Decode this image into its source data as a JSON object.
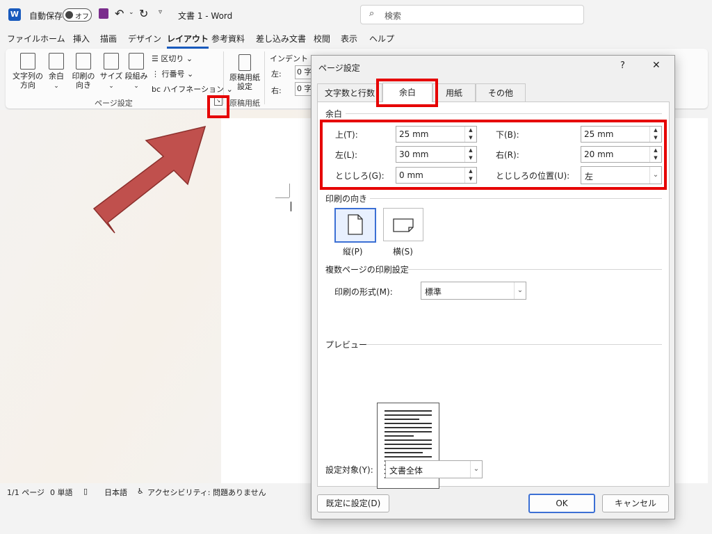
{
  "titlebar": {
    "autosave_label": "自動保存",
    "toggle_state": "オフ",
    "doc_title": "文書 1 - Word",
    "search_placeholder": "検索"
  },
  "menu": [
    "ファイル",
    "ホーム",
    "挿入",
    "描画",
    "デザイン",
    "レイアウト",
    "参考資料",
    "差し込み文書",
    "校閲",
    "表示",
    "ヘルプ"
  ],
  "menu_active": "レイアウト",
  "ribbon": {
    "text_direction": "文字列の\n方向",
    "margins": "余白",
    "orientation": "印刷の\n向き",
    "size": "サイズ",
    "columns": "段組み",
    "breaks": "区切り",
    "line_numbers": "行番号",
    "hyphenation": "ハイフネーション",
    "page_setup_group": "ページ設定",
    "genko": "原稿用紙\n設定",
    "genko_group": "原稿用紙",
    "indent_label": "インデント",
    "indent_left": "左:",
    "indent_right": "右:",
    "indent_unit": "0 字"
  },
  "dialog": {
    "title": "ページ設定",
    "help": "?",
    "close": "✕",
    "tabs": [
      "文字数と行数",
      "余白",
      "用紙",
      "その他"
    ],
    "active_tab": "余白",
    "margins_section": "余白",
    "top_label": "上(T):",
    "top_value": "25 mm",
    "bottom_label": "下(B):",
    "bottom_value": "25 mm",
    "left_label": "左(L):",
    "left_value": "30 mm",
    "right_label": "右(R):",
    "right_value": "20 mm",
    "gutter_label": "とじしろ(G):",
    "gutter_value": "0 mm",
    "gutter_pos_label": "とじしろの位置(U):",
    "gutter_pos_value": "左",
    "orientation_section": "印刷の向き",
    "portrait": "縦(P)",
    "landscape": "横(S)",
    "multipage_section": "複数ページの印刷設定",
    "print_format_label": "印刷の形式(M):",
    "print_format_value": "標準",
    "preview_section": "プレビュー",
    "apply_to_label": "設定対象(Y):",
    "apply_to_value": "文書全体",
    "default_button": "既定に設定(D)",
    "ok_button": "OK",
    "cancel_button": "キャンセル"
  },
  "statusbar": {
    "page": "1/1 ページ",
    "words": "0 単語",
    "language": "日本語",
    "accessibility": "アクセシビリティ: 問題ありません"
  },
  "colors": {
    "annotation_red": "#e60000",
    "arrow_fill": "#c0504d",
    "accent": "#185abd"
  }
}
